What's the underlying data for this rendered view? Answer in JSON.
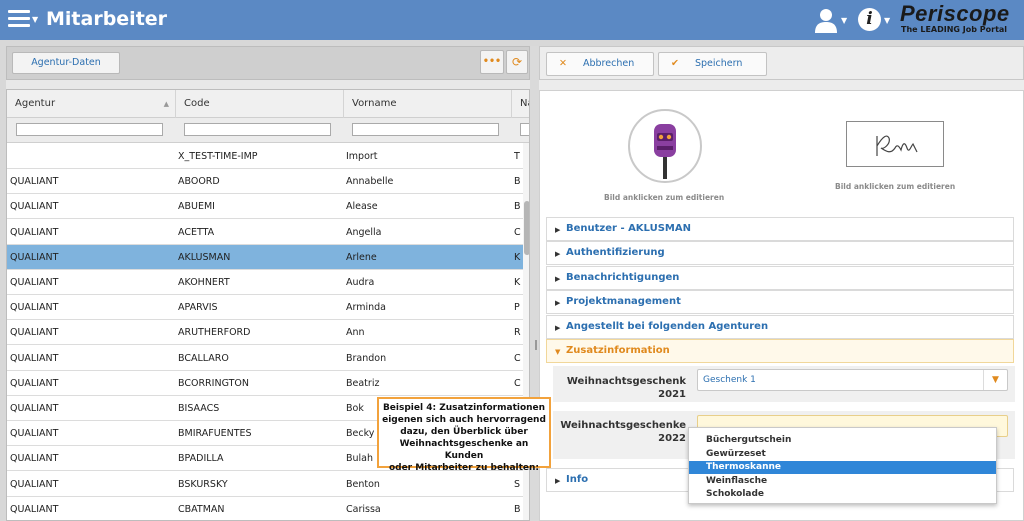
{
  "app": {
    "title": "Mitarbeiter",
    "logo_text": "Periscope",
    "logo_tagline": "The LEADING Job Portal"
  },
  "left_toolbar": {
    "agentur_button": "Agentur-Daten"
  },
  "grid": {
    "columns": [
      "Agentur",
      "Code",
      "Vorname",
      "Nac"
    ],
    "rows": [
      {
        "agentur": "",
        "code": "X_TEST-TIME-IMP",
        "vorname": "Import",
        "nachname": "T"
      },
      {
        "agentur": "QUALIANT",
        "code": "ABOORD",
        "vorname": "Annabelle",
        "nachname": "B"
      },
      {
        "agentur": "QUALIANT",
        "code": "ABUEMI",
        "vorname": "Alease",
        "nachname": "B"
      },
      {
        "agentur": "QUALIANT",
        "code": "ACETTA",
        "vorname": "Angella",
        "nachname": "C"
      },
      {
        "agentur": "QUALIANT",
        "code": "AKLUSMAN",
        "vorname": "Arlene",
        "nachname": "K",
        "selected": true
      },
      {
        "agentur": "QUALIANT",
        "code": "AKOHNERT",
        "vorname": "Audra",
        "nachname": "K"
      },
      {
        "agentur": "QUALIANT",
        "code": "APARVIS",
        "vorname": "Arminda",
        "nachname": "P"
      },
      {
        "agentur": "QUALIANT",
        "code": "ARUTHERFORD",
        "vorname": "Ann",
        "nachname": "R"
      },
      {
        "agentur": "QUALIANT",
        "code": "BCALLARO",
        "vorname": "Brandon",
        "nachname": "C"
      },
      {
        "agentur": "QUALIANT",
        "code": "BCORRINGTON",
        "vorname": "Beatriz",
        "nachname": "C"
      },
      {
        "agentur": "QUALIANT",
        "code": "BISAACS",
        "vorname": "Bok",
        "nachname": ""
      },
      {
        "agentur": "QUALIANT",
        "code": "BMIRAFUENTES",
        "vorname": "Becky",
        "nachname": ""
      },
      {
        "agentur": "QUALIANT",
        "code": "BPADILLA",
        "vorname": "Bulah",
        "nachname": ""
      },
      {
        "agentur": "QUALIANT",
        "code": "BSKURSKY",
        "vorname": "Benton",
        "nachname": "S"
      },
      {
        "agentur": "QUALIANT",
        "code": "CBATMAN",
        "vorname": "Carissa",
        "nachname": "B"
      }
    ]
  },
  "right_toolbar": {
    "cancel": "Abbrechen",
    "save": "Speichern"
  },
  "images": {
    "caption_left": "Bild anklicken zum editieren",
    "caption_right": "Bild anklicken zum editieren"
  },
  "sections": [
    {
      "label": "Benutzer - AKLUSMAN"
    },
    {
      "label": "Authentifizierung"
    },
    {
      "label": "Benachrichtigungen"
    },
    {
      "label": "Projektmanagement"
    },
    {
      "label": "Angestellt bei folgenden Agenturen"
    },
    {
      "label": "Zusatzinformation",
      "open": true
    }
  ],
  "fields": {
    "gift2021_label_1": "Weihnachtsgeschenk",
    "gift2021_label_2": "2021",
    "gift2021_value": "Geschenk 1",
    "gift2022_label_1": "Weihnachtsgeschenke",
    "gift2022_label_2": "2022"
  },
  "dropdown": {
    "options": [
      "Büchergutschein",
      "Gewürzeset",
      "Thermoskanne",
      "Weinflasche",
      "Schokolade"
    ],
    "highlighted": "Thermoskanne"
  },
  "info_section": "Info",
  "callout": {
    "line1": "Beispiel 4: Zusatzinformationen",
    "line2": "eigenen sich auch hervorragend",
    "line3": "dazu, den Überblick über",
    "line4": "Weihnachtsgeschenke an Kunden",
    "line5": "oder Mitarbeiter zu behalten:"
  }
}
